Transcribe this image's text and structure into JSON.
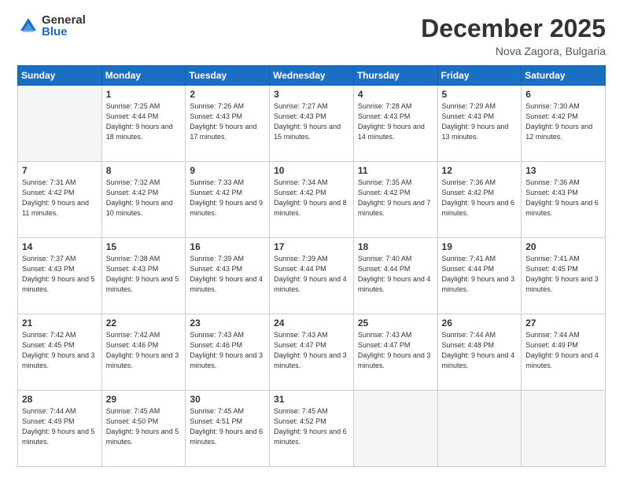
{
  "logo": {
    "general": "General",
    "blue": "Blue"
  },
  "title": "December 2025",
  "subtitle": "Nova Zagora, Bulgaria",
  "weekdays": [
    "Sunday",
    "Monday",
    "Tuesday",
    "Wednesday",
    "Thursday",
    "Friday",
    "Saturday"
  ],
  "weeks": [
    [
      {
        "day": "",
        "sunrise": "",
        "sunset": "",
        "daylight": "",
        "empty": true
      },
      {
        "day": "1",
        "sunrise": "7:25 AM",
        "sunset": "4:44 PM",
        "daylight": "9 hours and 18 minutes."
      },
      {
        "day": "2",
        "sunrise": "7:26 AM",
        "sunset": "4:43 PM",
        "daylight": "9 hours and 17 minutes."
      },
      {
        "day": "3",
        "sunrise": "7:27 AM",
        "sunset": "4:43 PM",
        "daylight": "9 hours and 15 minutes."
      },
      {
        "day": "4",
        "sunrise": "7:28 AM",
        "sunset": "4:43 PM",
        "daylight": "9 hours and 14 minutes."
      },
      {
        "day": "5",
        "sunrise": "7:29 AM",
        "sunset": "4:43 PM",
        "daylight": "9 hours and 13 minutes."
      },
      {
        "day": "6",
        "sunrise": "7:30 AM",
        "sunset": "4:42 PM",
        "daylight": "9 hours and 12 minutes."
      }
    ],
    [
      {
        "day": "7",
        "sunrise": "7:31 AM",
        "sunset": "4:42 PM",
        "daylight": "9 hours and 11 minutes."
      },
      {
        "day": "8",
        "sunrise": "7:32 AM",
        "sunset": "4:42 PM",
        "daylight": "9 hours and 10 minutes."
      },
      {
        "day": "9",
        "sunrise": "7:33 AM",
        "sunset": "4:42 PM",
        "daylight": "9 hours and 9 minutes."
      },
      {
        "day": "10",
        "sunrise": "7:34 AM",
        "sunset": "4:42 PM",
        "daylight": "9 hours and 8 minutes."
      },
      {
        "day": "11",
        "sunrise": "7:35 AM",
        "sunset": "4:42 PM",
        "daylight": "9 hours and 7 minutes."
      },
      {
        "day": "12",
        "sunrise": "7:36 AM",
        "sunset": "4:42 PM",
        "daylight": "9 hours and 6 minutes."
      },
      {
        "day": "13",
        "sunrise": "7:36 AM",
        "sunset": "4:43 PM",
        "daylight": "9 hours and 6 minutes."
      }
    ],
    [
      {
        "day": "14",
        "sunrise": "7:37 AM",
        "sunset": "4:43 PM",
        "daylight": "9 hours and 5 minutes."
      },
      {
        "day": "15",
        "sunrise": "7:38 AM",
        "sunset": "4:43 PM",
        "daylight": "9 hours and 5 minutes."
      },
      {
        "day": "16",
        "sunrise": "7:39 AM",
        "sunset": "4:43 PM",
        "daylight": "9 hours and 4 minutes."
      },
      {
        "day": "17",
        "sunrise": "7:39 AM",
        "sunset": "4:44 PM",
        "daylight": "9 hours and 4 minutes."
      },
      {
        "day": "18",
        "sunrise": "7:40 AM",
        "sunset": "4:44 PM",
        "daylight": "9 hours and 4 minutes."
      },
      {
        "day": "19",
        "sunrise": "7:41 AM",
        "sunset": "4:44 PM",
        "daylight": "9 hours and 3 minutes."
      },
      {
        "day": "20",
        "sunrise": "7:41 AM",
        "sunset": "4:45 PM",
        "daylight": "9 hours and 3 minutes."
      }
    ],
    [
      {
        "day": "21",
        "sunrise": "7:42 AM",
        "sunset": "4:45 PM",
        "daylight": "9 hours and 3 minutes."
      },
      {
        "day": "22",
        "sunrise": "7:42 AM",
        "sunset": "4:46 PM",
        "daylight": "9 hours and 3 minutes."
      },
      {
        "day": "23",
        "sunrise": "7:43 AM",
        "sunset": "4:46 PM",
        "daylight": "9 hours and 3 minutes."
      },
      {
        "day": "24",
        "sunrise": "7:43 AM",
        "sunset": "4:47 PM",
        "daylight": "9 hours and 3 minutes."
      },
      {
        "day": "25",
        "sunrise": "7:43 AM",
        "sunset": "4:47 PM",
        "daylight": "9 hours and 3 minutes."
      },
      {
        "day": "26",
        "sunrise": "7:44 AM",
        "sunset": "4:48 PM",
        "daylight": "9 hours and 4 minutes."
      },
      {
        "day": "27",
        "sunrise": "7:44 AM",
        "sunset": "4:49 PM",
        "daylight": "9 hours and 4 minutes."
      }
    ],
    [
      {
        "day": "28",
        "sunrise": "7:44 AM",
        "sunset": "4:49 PM",
        "daylight": "9 hours and 5 minutes."
      },
      {
        "day": "29",
        "sunrise": "7:45 AM",
        "sunset": "4:50 PM",
        "daylight": "9 hours and 5 minutes."
      },
      {
        "day": "30",
        "sunrise": "7:45 AM",
        "sunset": "4:51 PM",
        "daylight": "9 hours and 6 minutes."
      },
      {
        "day": "31",
        "sunrise": "7:45 AM",
        "sunset": "4:52 PM",
        "daylight": "9 hours and 6 minutes."
      },
      {
        "day": "",
        "sunrise": "",
        "sunset": "",
        "daylight": "",
        "empty": true
      },
      {
        "day": "",
        "sunrise": "",
        "sunset": "",
        "daylight": "",
        "empty": true
      },
      {
        "day": "",
        "sunrise": "",
        "sunset": "",
        "daylight": "",
        "empty": true
      }
    ]
  ]
}
